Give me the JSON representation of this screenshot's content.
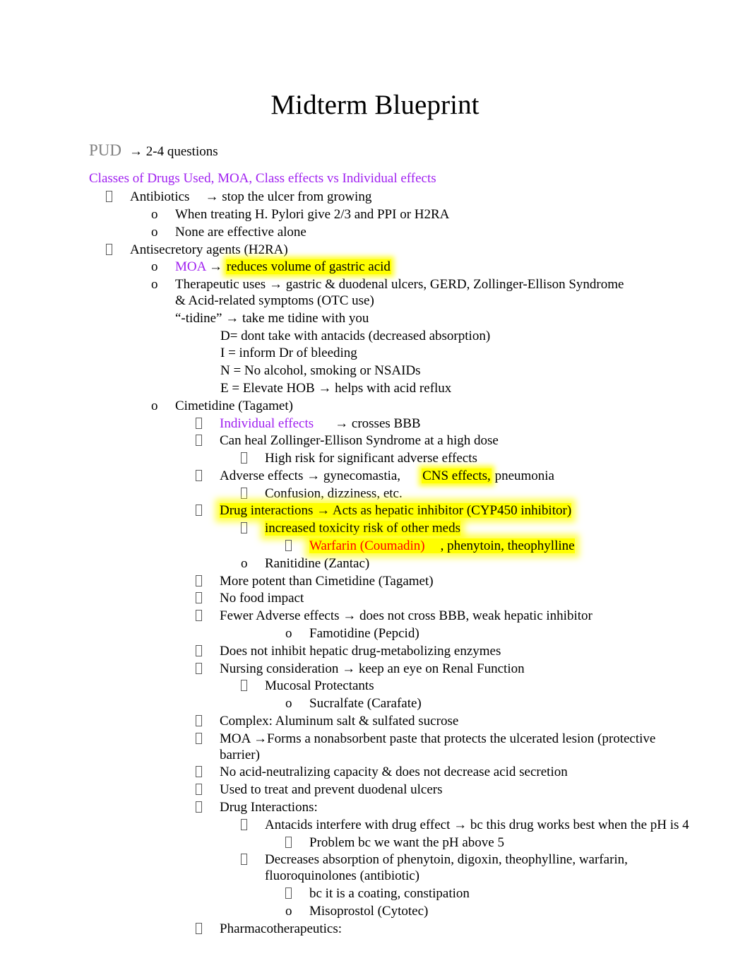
{
  "document": {
    "title": "Midterm Blueprint",
    "section": {
      "label": "PUD",
      "arrow": "→",
      "qty": "2-4 questions"
    },
    "topic_heading": "Classes of Drugs Used, MOA, Class effects vs Individual effects"
  },
  "outline": {
    "antibiotics": {
      "label": "Antibiotics",
      "arrow": "→",
      "detail": "stop the ulcer from growing",
      "sub1": "When treating H. Pylori give 2/3 and PPI or H2RA",
      "sub2": "None are effective alone"
    },
    "antisecretory": {
      "label": "Antisecretory agents (H2RA)",
      "moa_label": "MOA",
      "moa_arrow": "→",
      "moa_text": "reduces volume of gastric acid",
      "therapeutic_label": "Therapeutic uses",
      "therapeutic_arrow": "→",
      "therapeutic_text": "gastric & duodenal ulcers, GERD, Zollinger-Ellison Syndrome & Acid-related symptoms (OTC use)",
      "tidine_mnemonic": "“-tidine” → take me tidine with you",
      "mnemonic": {
        "d": "D= dont take with antacids (decreased absorption)",
        "i": "I = inform Dr of bleeding",
        "n": "N = No alcohol, smoking or NSAIDs",
        "e": "E = Elevate HOB → helps with acid reflux"
      }
    },
    "cimetidine": {
      "label": "Cimetidine (Tagamet)",
      "individual_effects_label": "Individual effects",
      "individual_effects_arrow": "→",
      "individual_effects_text": "crosses BBB",
      "zollinger": "Can heal Zollinger-Ellison Syndrome at a high dose",
      "zollinger_sub": "High risk for significant adverse effects",
      "adverse_label": "Adverse effects",
      "adverse_arrow": "→",
      "adverse_text_a": "gynecomastia,",
      "adverse_text_hl": "CNS effects,",
      "adverse_text_b": "pneumonia",
      "adverse_sub": "Confusion, dizziness, etc.",
      "drug_interactions": "Drug interactions → Acts as hepatic inhibitor (CYP450 inhibitor)",
      "drug_interactions_sub": "increased toxicity risk of other meds",
      "warfarin": "Warfarin (Coumadin)",
      "warfarin_rest": ", phenytoin, theophylline"
    },
    "ranitidine": {
      "label": "Ranitidine (Zantac)",
      "points": [
        "More potent than Cimetidine (Tagamet)",
        "No food impact"
      ],
      "fewer_adverse": "Fewer Adverse effects → does not cross BBB, weak hepatic inhibitor"
    },
    "famotidine": {
      "label": "Famotidine (Pepcid)",
      "points": [
        "Does not inhibit hepatic drug-metabolizing enzymes",
        "Nursing consideration → keep an eye on Renal Function"
      ]
    },
    "mucosal": {
      "label": "Mucosal Protectants"
    },
    "sucralfate": {
      "label": "Sucralfate (Carafate)",
      "complex": "Complex: Aluminum salt & sulfated sucrose",
      "moa": "MOA →Forms a nonabsorbent paste that protects the ulcerated lesion (protective barrier)",
      "no_acid": "No acid-neutralizing capacity & does not decrease acid secretion",
      "used_to": "Used to treat and prevent duodenal ulcers",
      "drug_interactions_label": "Drug Interactions:",
      "antacids": "Antacids interfere with drug effect → bc this drug works best when the pH is 4",
      "antacids_sub": "Problem bc we want the pH above 5",
      "decreases": "Decreases absorption of phenytoin, digoxin, theophylline, warfarin, fluoroquinolones (antibiotic)",
      "decreases_sub": "bc it is a coating, constipation"
    },
    "misoprostol": {
      "label": "Misoprostol (Cytotec)",
      "pharmacotherapeutics": "Pharmacotherapeutics:"
    }
  },
  "colors": {
    "highlight": "#ffff00",
    "purple": "#a020f0",
    "red": "#ff0000",
    "gray_heading": "#808080",
    "body_text": "#000000"
  }
}
